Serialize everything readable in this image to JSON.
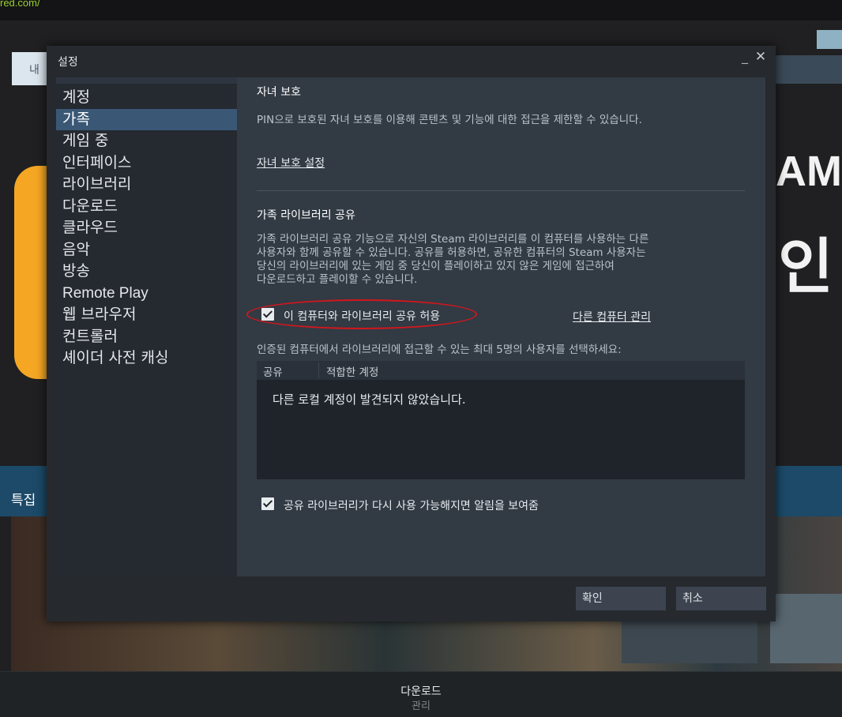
{
  "browser": {
    "url_fragment": "red.com/"
  },
  "background": {
    "tab_label": "내 ",
    "headline_fragment": "AM",
    "headline_fragment2": "인",
    "feature_label": "특집"
  },
  "bottom_bar": {
    "downloads": "다운로드",
    "manage": "관리"
  },
  "dialog": {
    "title": "설정",
    "minimize_glyph": "_",
    "close_glyph": "✕",
    "sidebar": [
      {
        "label": "계정"
      },
      {
        "label": "가족"
      },
      {
        "label": "게임 중"
      },
      {
        "label": "인터페이스"
      },
      {
        "label": "라이브러리"
      },
      {
        "label": "다운로드"
      },
      {
        "label": "클라우드"
      },
      {
        "label": "음악"
      },
      {
        "label": "방송"
      },
      {
        "label": "Remote Play"
      },
      {
        "label": "웹 브라우저"
      },
      {
        "label": "컨트롤러"
      },
      {
        "label": "셰이더 사전 캐싱"
      }
    ],
    "active_item": "가족",
    "family": {
      "parental_title": "자녀 보호",
      "parental_desc": "PIN으로 보호된 자녀 보호를 이용해 콘텐츠 및 기능에 대한 접근을 제한할 수 있습니다.",
      "parental_link": "자녀 보호 설정",
      "sharing_title": "가족 라이브러리 공유",
      "sharing_desc": "가족 라이브러리 공유 기능으로 자신의 Steam 라이브러리를 이 컴퓨터를 사용하는 다른\n사용자와 함께 공유할 수 있습니다. 공유를 허용하면, 공유한 컴퓨터의 Steam 사용자는\n당신의 라이브러리에 있는 게임 중 당신이 플레이하고 있지 않은 게임에 접근하여\n다운로드하고 플레이할 수 있습니다.",
      "allow_sharing_label": "이 컴퓨터와 라이브러리 공유 허용",
      "allow_sharing_checked": true,
      "manage_link": "다른 컴퓨터 관리",
      "select_users_desc": "인증된 컴퓨터에서 라이브러리에 접근할 수 있는 최대 5명의 사용자를 선택하세요:",
      "table": {
        "col_share": "공유",
        "col_account": "적합한 계정",
        "empty_message": "다른 로컬 계정이 발견되지 않았습니다."
      },
      "notify_label": "공유 라이브러리가 다시 사용 가능해지면 알림을 보여줌",
      "notify_checked": true
    },
    "buttons": {
      "ok": "확인",
      "cancel": "취소"
    },
    "highlight_color": "#d3161b",
    "active_color": "#3a5876"
  }
}
